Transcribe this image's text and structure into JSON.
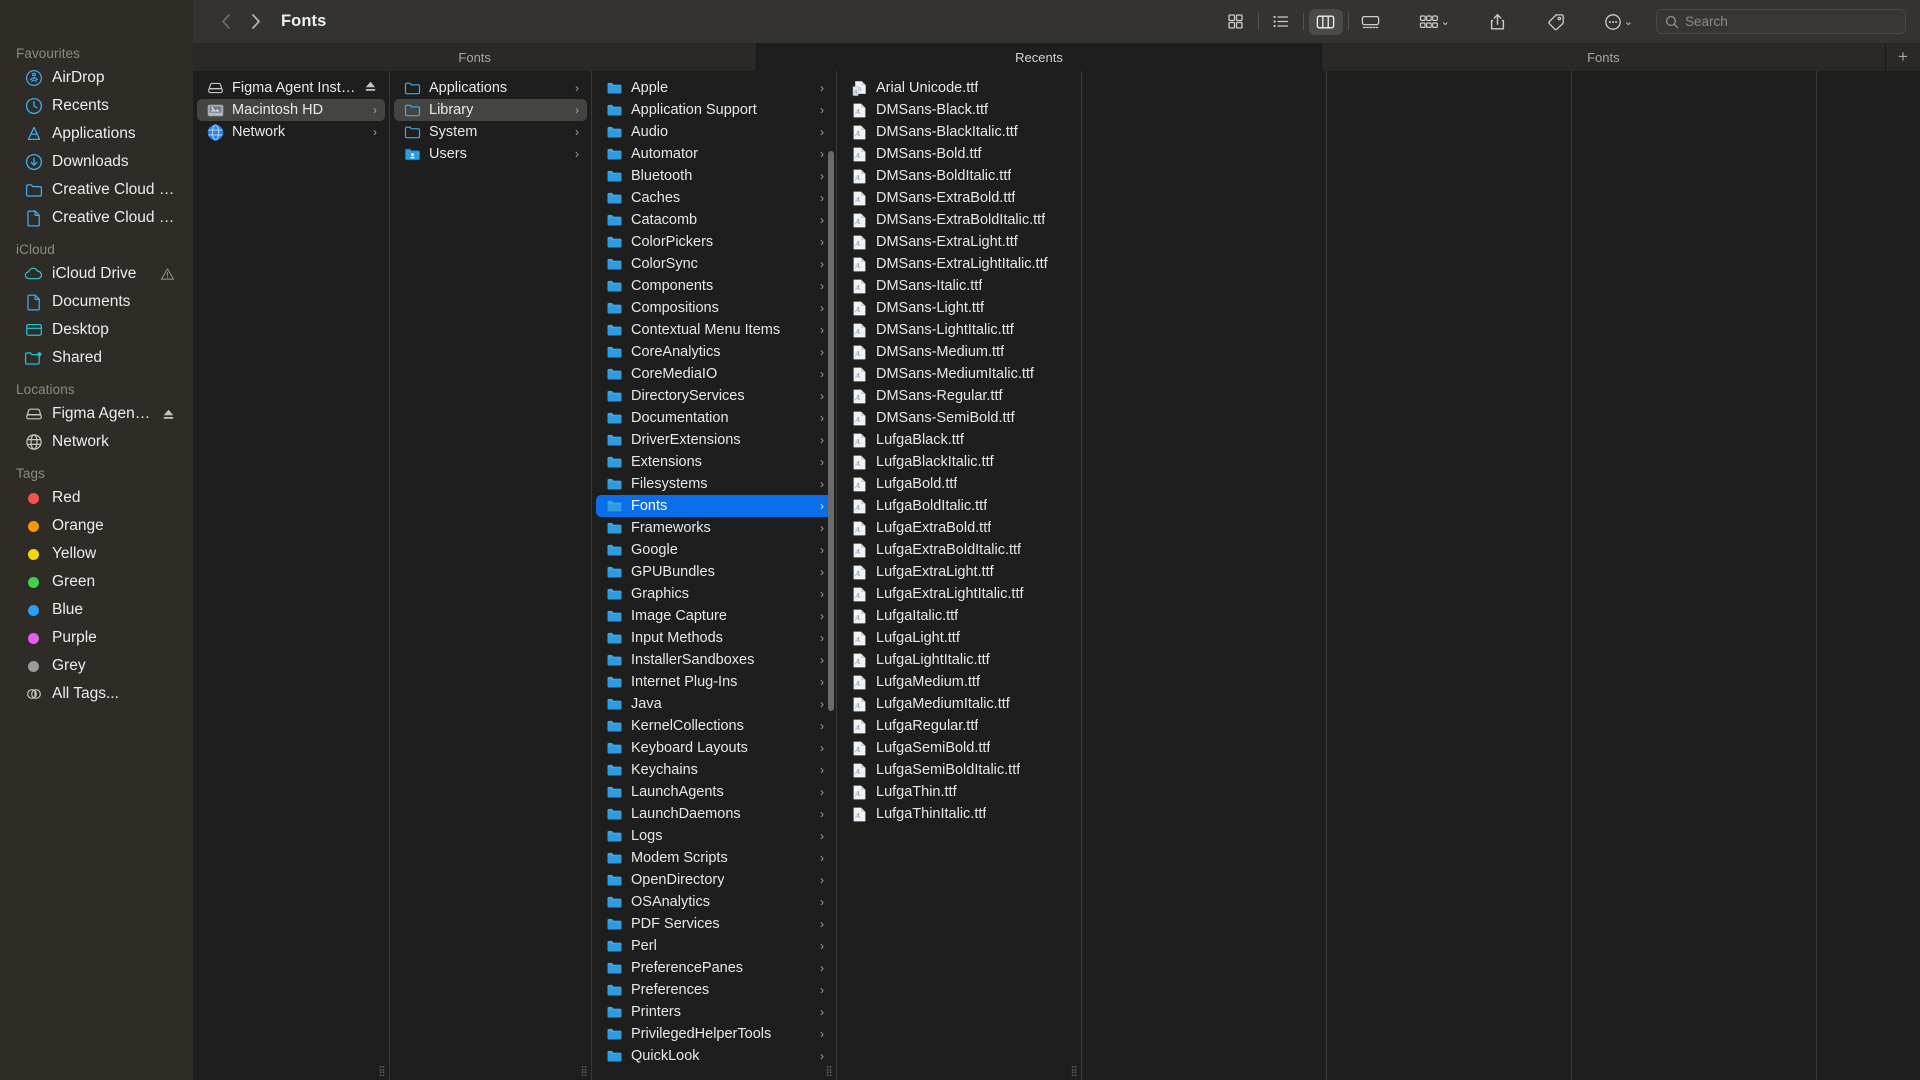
{
  "toolbar": {
    "back_label": "‹",
    "forward_label": "›",
    "title": "Fonts",
    "icons": {
      "icon_view": "grid-view-icon",
      "list_view": "list-view-icon",
      "column_view": "column-view-icon",
      "gallery_view": "gallery-view-icon",
      "group_by": "group-by-icon",
      "share": "share-icon",
      "tag": "tag-icon",
      "more": "more-options-icon"
    },
    "search_placeholder": "Search"
  },
  "tabs": [
    {
      "label": "Fonts",
      "active": false
    },
    {
      "label": "Recents",
      "active": true
    },
    {
      "label": "Fonts",
      "active": false
    }
  ],
  "tab_add_label": "+",
  "sidebar": {
    "sections": [
      {
        "title": "Favourites",
        "items": [
          {
            "label": "AirDrop",
            "icon": "airdrop-icon"
          },
          {
            "label": "Recents",
            "icon": "clock-icon"
          },
          {
            "label": "Applications",
            "icon": "applications-icon"
          },
          {
            "label": "Downloads",
            "icon": "downloads-icon"
          },
          {
            "label": "Creative Cloud Files...",
            "icon": "folder-icon"
          },
          {
            "label": "Creative Cloud Files",
            "icon": "document-icon"
          }
        ]
      },
      {
        "title": "iCloud",
        "items": [
          {
            "label": "iCloud Drive",
            "icon": "cloud-icon",
            "badge": "warning-icon"
          },
          {
            "label": "Documents",
            "icon": "document-icon"
          },
          {
            "label": "Desktop",
            "icon": "desktop-icon"
          },
          {
            "label": "Shared",
            "icon": "shared-folder-icon"
          }
        ]
      },
      {
        "title": "Locations",
        "items": [
          {
            "label": "Figma Agent Inst...",
            "icon": "disk-icon",
            "badge": "eject-icon"
          },
          {
            "label": "Network",
            "icon": "globe-icon"
          }
        ]
      },
      {
        "title": "Tags",
        "items": [
          {
            "label": "Red",
            "icon": "tag-dot-icon",
            "color": "#f2564b"
          },
          {
            "label": "Orange",
            "icon": "tag-dot-icon",
            "color": "#f5960c"
          },
          {
            "label": "Yellow",
            "icon": "tag-dot-icon",
            "color": "#f5d312"
          },
          {
            "label": "Green",
            "icon": "tag-dot-icon",
            "color": "#41d04f"
          },
          {
            "label": "Blue",
            "icon": "tag-dot-icon",
            "color": "#2d9cf5"
          },
          {
            "label": "Purple",
            "icon": "tag-dot-icon",
            "color": "#e45df0"
          },
          {
            "label": "Grey",
            "icon": "tag-dot-icon",
            "color": "#9a9a9a"
          },
          {
            "label": "All Tags...",
            "icon": "all-tags-icon"
          }
        ]
      }
    ]
  },
  "columns": {
    "volumes": [
      {
        "label": "Figma Agent Installer",
        "icon": "disk-icon",
        "selected": false,
        "eject": true
      },
      {
        "label": "Macintosh HD",
        "icon": "hd-icon",
        "selected": true,
        "arrow": true
      },
      {
        "label": "Network",
        "icon": "globe-icon",
        "selected": false,
        "arrow": true
      }
    ],
    "root": [
      {
        "label": "Applications",
        "icon": "folder-icon",
        "arrow": true
      },
      {
        "label": "Library",
        "icon": "folder-icon",
        "arrow": true,
        "selected": true
      },
      {
        "label": "System",
        "icon": "folder-icon",
        "arrow": true
      },
      {
        "label": "Users",
        "icon": "folder-users-icon",
        "arrow": true
      }
    ],
    "library": [
      {
        "label": "Apple",
        "arrow": true
      },
      {
        "label": "Application Support",
        "arrow": true
      },
      {
        "label": "Audio",
        "arrow": true
      },
      {
        "label": "Automator",
        "arrow": true
      },
      {
        "label": "Bluetooth",
        "arrow": true
      },
      {
        "label": "Caches",
        "arrow": true
      },
      {
        "label": "Catacomb",
        "arrow": true
      },
      {
        "label": "ColorPickers",
        "arrow": true
      },
      {
        "label": "ColorSync",
        "arrow": true
      },
      {
        "label": "Components",
        "arrow": true
      },
      {
        "label": "Compositions",
        "arrow": true
      },
      {
        "label": "Contextual Menu Items",
        "arrow": true
      },
      {
        "label": "CoreAnalytics",
        "arrow": true
      },
      {
        "label": "CoreMediaIO",
        "arrow": true
      },
      {
        "label": "DirectoryServices",
        "arrow": true
      },
      {
        "label": "Documentation",
        "arrow": true
      },
      {
        "label": "DriverExtensions",
        "arrow": true
      },
      {
        "label": "Extensions",
        "arrow": true
      },
      {
        "label": "Filesystems",
        "arrow": true
      },
      {
        "label": "Fonts",
        "arrow": true,
        "selected": true
      },
      {
        "label": "Frameworks",
        "arrow": true
      },
      {
        "label": "Google",
        "arrow": true
      },
      {
        "label": "GPUBundles",
        "arrow": true
      },
      {
        "label": "Graphics",
        "arrow": true
      },
      {
        "label": "Image Capture",
        "arrow": true
      },
      {
        "label": "Input Methods",
        "arrow": true
      },
      {
        "label": "InstallerSandboxes",
        "arrow": true
      },
      {
        "label": "Internet Plug-Ins",
        "arrow": true
      },
      {
        "label": "Java",
        "arrow": true
      },
      {
        "label": "KernelCollections",
        "arrow": true
      },
      {
        "label": "Keyboard Layouts",
        "arrow": true
      },
      {
        "label": "Keychains",
        "arrow": true
      },
      {
        "label": "LaunchAgents",
        "arrow": true
      },
      {
        "label": "LaunchDaemons",
        "arrow": true
      },
      {
        "label": "Logs",
        "arrow": true
      },
      {
        "label": "Modem Scripts",
        "arrow": true
      },
      {
        "label": "OpenDirectory",
        "arrow": true
      },
      {
        "label": "OSAnalytics",
        "arrow": true
      },
      {
        "label": "PDF Services",
        "arrow": true
      },
      {
        "label": "Perl",
        "arrow": true
      },
      {
        "label": "PreferencePanes",
        "arrow": true
      },
      {
        "label": "Preferences",
        "arrow": true
      },
      {
        "label": "Printers",
        "arrow": true
      },
      {
        "label": "PrivilegedHelperTools",
        "arrow": true
      },
      {
        "label": "QuickLook",
        "arrow": true
      }
    ],
    "fonts": [
      {
        "label": "Arial Unicode.ttf",
        "icon": "font-file-icon"
      },
      {
        "label": "DMSans-Black.ttf",
        "icon": "font-file-icon"
      },
      {
        "label": "DMSans-BlackItalic.ttf",
        "icon": "font-file-icon"
      },
      {
        "label": "DMSans-Bold.ttf",
        "icon": "font-file-icon"
      },
      {
        "label": "DMSans-BoldItalic.ttf",
        "icon": "font-file-icon"
      },
      {
        "label": "DMSans-ExtraBold.ttf",
        "icon": "font-file-icon"
      },
      {
        "label": "DMSans-ExtraBoldItalic.ttf",
        "icon": "font-file-icon"
      },
      {
        "label": "DMSans-ExtraLight.ttf",
        "icon": "font-file-icon"
      },
      {
        "label": "DMSans-ExtraLightItalic.ttf",
        "icon": "font-file-icon"
      },
      {
        "label": "DMSans-Italic.ttf",
        "icon": "font-file-icon"
      },
      {
        "label": "DMSans-Light.ttf",
        "icon": "font-file-icon"
      },
      {
        "label": "DMSans-LightItalic.ttf",
        "icon": "font-file-icon"
      },
      {
        "label": "DMSans-Medium.ttf",
        "icon": "font-file-icon"
      },
      {
        "label": "DMSans-MediumItalic.ttf",
        "icon": "font-file-icon"
      },
      {
        "label": "DMSans-Regular.ttf",
        "icon": "font-file-icon"
      },
      {
        "label": "DMSans-SemiBold.ttf",
        "icon": "font-file-icon"
      },
      {
        "label": "LufgaBlack.ttf",
        "icon": "font-file-icon"
      },
      {
        "label": "LufgaBlackItalic.ttf",
        "icon": "font-file-icon"
      },
      {
        "label": "LufgaBold.ttf",
        "icon": "font-file-icon"
      },
      {
        "label": "LufgaBoldItalic.ttf",
        "icon": "font-file-icon"
      },
      {
        "label": "LufgaExtraBold.ttf",
        "icon": "font-file-icon"
      },
      {
        "label": "LufgaExtraBoldItalic.ttf",
        "icon": "font-file-icon"
      },
      {
        "label": "LufgaExtraLight.ttf",
        "icon": "font-file-icon"
      },
      {
        "label": "LufgaExtraLightItalic.ttf",
        "icon": "font-file-icon"
      },
      {
        "label": "LufgaItalic.ttf",
        "icon": "font-file-icon"
      },
      {
        "label": "LufgaLight.ttf",
        "icon": "font-file-icon"
      },
      {
        "label": "LufgaLightItalic.ttf",
        "icon": "font-file-icon"
      },
      {
        "label": "LufgaMedium.ttf",
        "icon": "font-file-icon"
      },
      {
        "label": "LufgaMediumItalic.ttf",
        "icon": "font-file-icon"
      },
      {
        "label": "LufgaRegular.ttf",
        "icon": "font-file-icon"
      },
      {
        "label": "LufgaSemiBold.ttf",
        "icon": "font-file-icon"
      },
      {
        "label": "LufgaSemiBoldItalic.ttf",
        "icon": "font-file-icon"
      },
      {
        "label": "LufgaThin.ttf",
        "icon": "font-file-icon"
      },
      {
        "label": "LufgaThinItalic.ttf",
        "icon": "font-file-icon"
      }
    ]
  },
  "colors": {
    "selection_blue": "#0a6ee8",
    "sidebar_bg": "#2f2c28",
    "pane_bg": "#1e1e1e",
    "toolbar_bg": "#343330",
    "folder_blue": "#3aaef0"
  }
}
